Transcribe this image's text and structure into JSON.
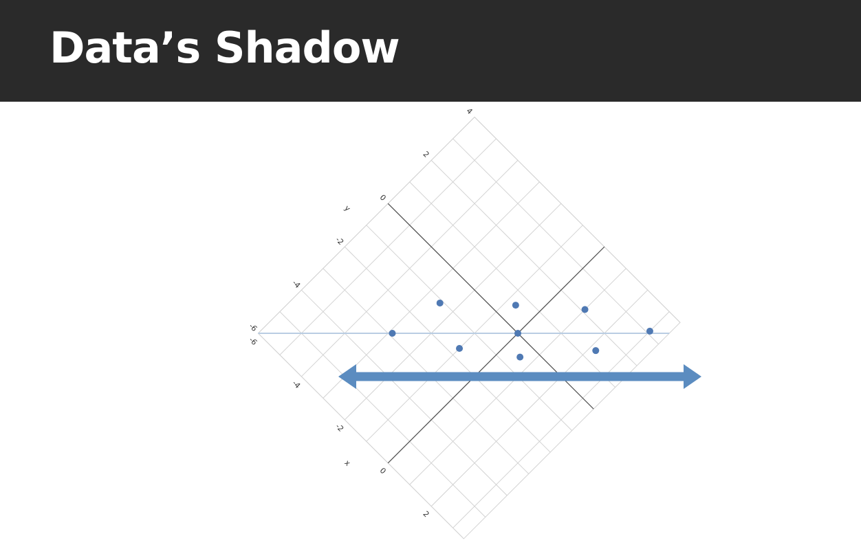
{
  "slide": {
    "title": "Data’s Shadow"
  },
  "chart_data": {
    "type": "scatter",
    "title": "",
    "xlabel": "x",
    "ylabel": "y",
    "xlim": [
      -6,
      3.5
    ],
    "ylim": [
      -6,
      4
    ],
    "x_ticks": [
      "-6",
      "-4",
      "-2",
      "0",
      "2"
    ],
    "y_ticks": [
      "-6",
      "-4",
      "-2",
      "0",
      "2",
      "4"
    ],
    "grid": true,
    "axes_rotated_deg": 45,
    "series": [
      {
        "points": [
          {
            "x": -2.9,
            "y": -2.9
          },
          {
            "x": -2.5,
            "y": -1.1
          },
          {
            "x": -1.0,
            "y": -1.7
          },
          {
            "x": -0.7,
            "y": 0.6
          },
          {
            "x": 0.0,
            "y": 0.0
          },
          {
            "x": 0.6,
            "y": -0.5
          },
          {
            "x": 1.0,
            "y": 2.1
          },
          {
            "x": 2.2,
            "y": 1.4
          },
          {
            "x": 3.0,
            "y": 3.1
          }
        ]
      }
    ],
    "projection_line": true,
    "arrow": "double-headed horizontal"
  },
  "colors": {
    "title_bar": "#2a2a2a",
    "title_text": "#ffffff",
    "points": "#4f79b3",
    "projection_line": "#b9cde3",
    "arrow": "#5b8cc0",
    "grid": "#d3d3d3",
    "axes": "#4a4a4a"
  }
}
